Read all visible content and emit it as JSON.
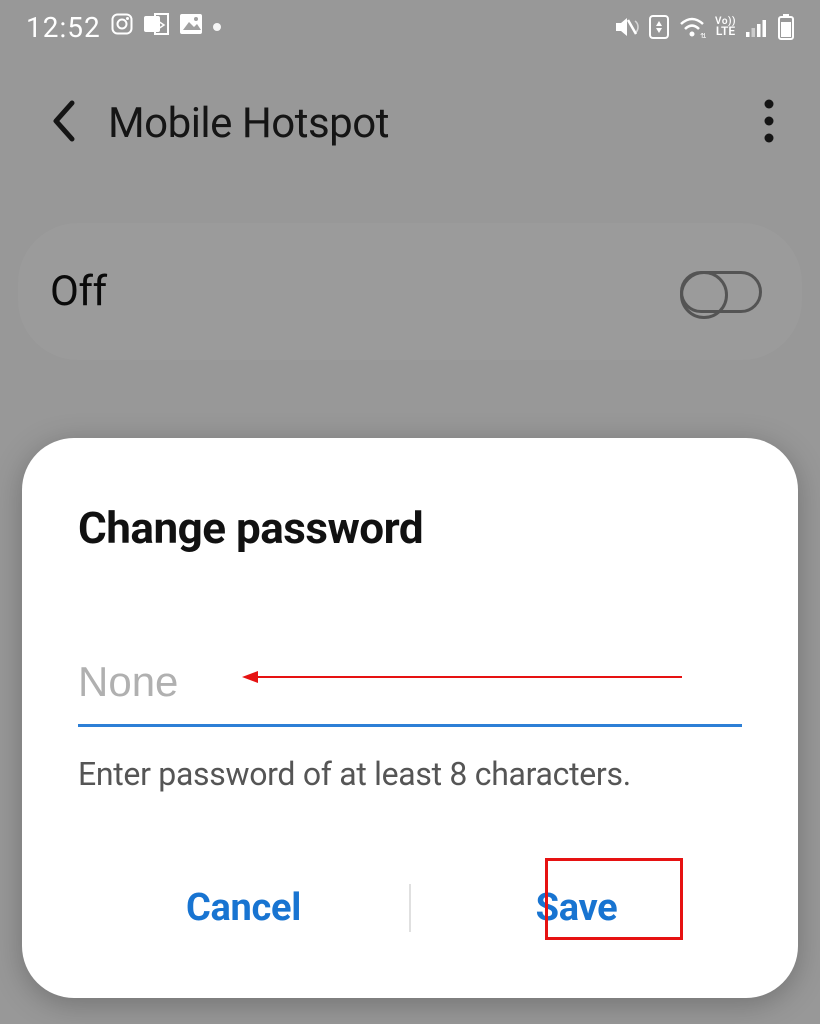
{
  "statusbar": {
    "time": "12:52",
    "lte_top": "Vo))",
    "lte_bottom": "LTE"
  },
  "appbar": {
    "title": "Mobile Hotspot"
  },
  "toggle": {
    "label": "Off"
  },
  "dialog": {
    "title": "Change password",
    "input_placeholder": "None",
    "input_value": "",
    "helper": "Enter password of at least 8 characters.",
    "cancel": "Cancel",
    "save": "Save"
  },
  "colors": {
    "accent": "#1874d1",
    "underline": "#2d7fd6",
    "annotation": "#e61212"
  }
}
